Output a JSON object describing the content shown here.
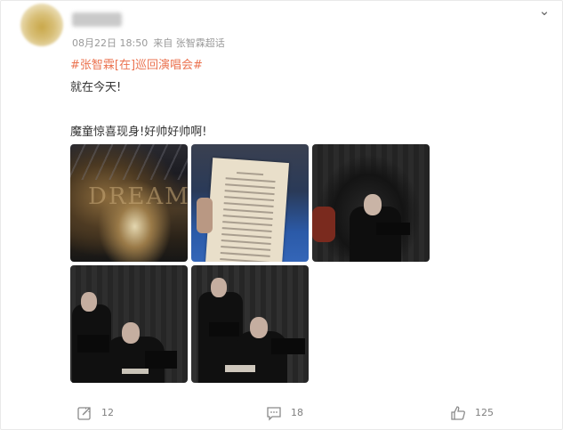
{
  "post": {
    "timestamp": "08月22日 18:50",
    "source": "来自 张智霖超话",
    "topic": "#张智霖[在]巡回演唱会#",
    "line1": "就在今天!",
    "line2": "魔童惊喜现身!好帅好帅啊!"
  },
  "actions": {
    "repost_count": "12",
    "comment_count": "18",
    "like_count": "125"
  },
  "icons": {
    "more": "chevron-down-icon",
    "repost": "repost-icon",
    "comment": "comment-icon",
    "like": "thumbs-up-icon"
  },
  "colors": {
    "topic": "#eb7350",
    "meta": "#999999",
    "action": "#808080"
  }
}
